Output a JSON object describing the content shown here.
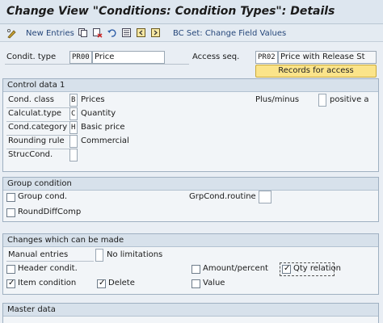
{
  "title": "Change View \"Conditions: Condition Types\": Details",
  "toolbar": {
    "new_entries": "New Entries",
    "bc_set": "BC Set: Change Field Values"
  },
  "header": {
    "condit_type_label": "Condit. type",
    "condit_type_code": "PR00",
    "condit_type_name": "Price",
    "access_seq_label": "Access seq.",
    "access_seq_code": "PR02",
    "access_seq_name": "Price with Release St",
    "records_button": "Records for access"
  },
  "control_data": {
    "title": "Control data 1",
    "cond_class_label": "Cond. class",
    "cond_class_code": "B",
    "cond_class_text": "Prices",
    "calc_type_label": "Calculat.type",
    "calc_type_code": "C",
    "calc_type_text": "Quantity",
    "cond_category_label": "Cond.category",
    "cond_category_code": "H",
    "cond_category_text": "Basic price",
    "rounding_label": "Rounding rule",
    "rounding_code": "",
    "rounding_text": "Commercial",
    "struc_label": "StrucCond.",
    "struc_code": "",
    "plus_minus_label": "Plus/minus",
    "plus_minus_code": "",
    "plus_minus_text": "positive a"
  },
  "group_condition": {
    "title": "Group condition",
    "group_cond_label": "Group cond.",
    "group_cond_checked": false,
    "grp_routine_label": "GrpCond.routine",
    "grp_routine_value": "",
    "round_diff_label": "RoundDiffComp",
    "round_diff_checked": false
  },
  "changes": {
    "title": "Changes which can be made",
    "manual_entries_label": "Manual entries",
    "manual_entries_code": "",
    "manual_entries_text": "No limitations",
    "header_condit_label": "Header condit.",
    "header_condit_checked": false,
    "amount_percent_label": "Amount/percent",
    "amount_percent_checked": false,
    "qty_relation_label": "Qty relation",
    "qty_relation_checked": true,
    "item_condition_label": "Item condition",
    "item_condition_checked": true,
    "delete_label": "Delete",
    "delete_checked": true,
    "value_label": "Value",
    "value_checked": false
  },
  "master_data": {
    "title": "Master data"
  },
  "colors": {
    "button_yellow": "#fbe48a",
    "link_blue": "#26477a",
    "group_header": "#d7e1eb"
  }
}
